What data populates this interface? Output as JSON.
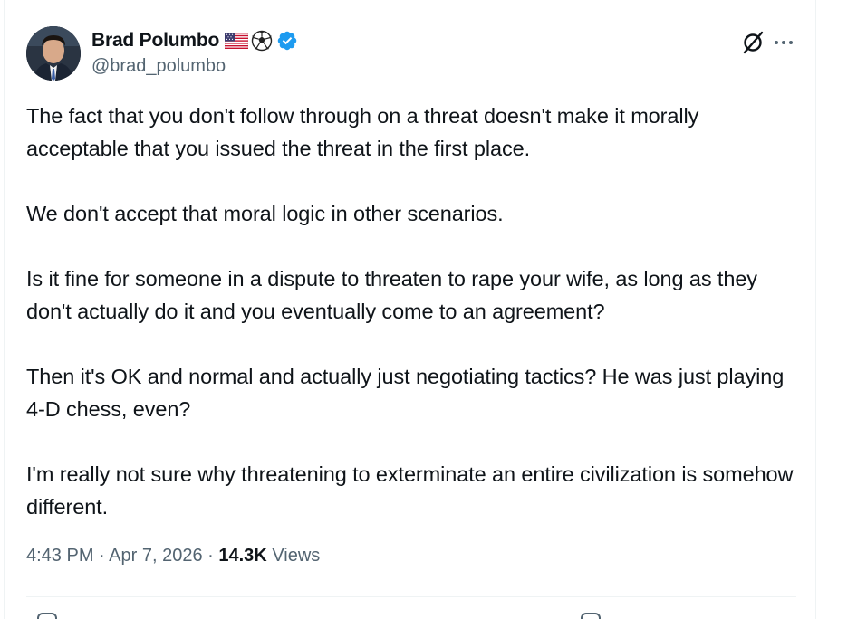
{
  "tweet": {
    "author": {
      "display_name": "Brad Polumbo",
      "handle": "@brad_polumbo",
      "emojis": [
        "us-flag-icon",
        "soccer-ball-icon"
      ],
      "verified": true
    },
    "paragraphs": [
      "The fact that you don't follow through on a threat doesn't make it morally acceptable that you issued the threat in the first place.",
      "We don't accept that moral logic in other scenarios.",
      "Is it fine for someone in a dispute to threaten to rape your wife, as long as they don't actually do it and you eventually come to an agreement?",
      "Then it's OK and normal and actually just negotiating tactics? He was just playing 4-D chess, even?",
      "I'm really not sure why threatening to exterminate an entire civilization is somehow different."
    ],
    "time": "4:43 PM",
    "separator": "·",
    "date": "Apr 7, 2026",
    "views_count": "14.3K",
    "views_label": "Views"
  },
  "colors": {
    "text_primary": "#0f1419",
    "text_secondary": "#536471",
    "verified_blue": "#1d9bf0",
    "divider": "#eff3f4"
  },
  "icons": {
    "grok": "grok-icon",
    "more": "more-options-icon",
    "verified": "verified-badge-icon"
  }
}
